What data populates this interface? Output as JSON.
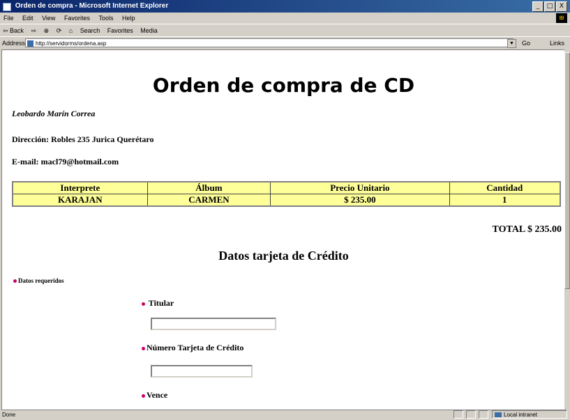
{
  "window": {
    "title": "Orden de compra - Microsoft Internet Explorer",
    "buttons": [
      "_",
      "□",
      "X"
    ]
  },
  "menu": [
    "File",
    "Edit",
    "View",
    "Favorites",
    "Tools",
    "Help"
  ],
  "toolbar": {
    "back": "⇦ Back",
    "forward": "⇨",
    "stop": "⊗",
    "refresh": "⟳",
    "home": "⌂",
    "search": "Search",
    "favorites": "Favorites",
    "media": "Media"
  },
  "address": {
    "label": "Address",
    "url": "http://servidorms/ordena.asp",
    "go": "Go",
    "links": "Links"
  },
  "page": {
    "title": "Orden de compra de CD",
    "customer_name": "Leobardo  Marín Correa",
    "address_line": "Dirección: Robles 235 Jurica Querétaro",
    "email_line": "E-mail: macl79@hotmail.com",
    "table": {
      "headers": [
        "Interprete",
        "Álbum",
        "Precio Unitario",
        "Cantidad"
      ],
      "rows": [
        [
          "KARAJAN",
          "CARMEN",
          "$ 235.00",
          "1"
        ]
      ]
    },
    "total": "TOTAL $ 235.00",
    "section_title": "Datos tarjeta de Crédito",
    "required_note": "Datos requeridos",
    "fields": {
      "holder_label": "Titular",
      "holder_value": "",
      "card_label": "Número Tarjeta de Crédito",
      "card_value": "",
      "expires_label": "Vence"
    }
  },
  "status": {
    "text": "Done",
    "zone": "Local intranet"
  },
  "colors": {
    "table_bg": "#ffff99",
    "bullet": "#cc0066",
    "titlebar": "#0a246a"
  }
}
